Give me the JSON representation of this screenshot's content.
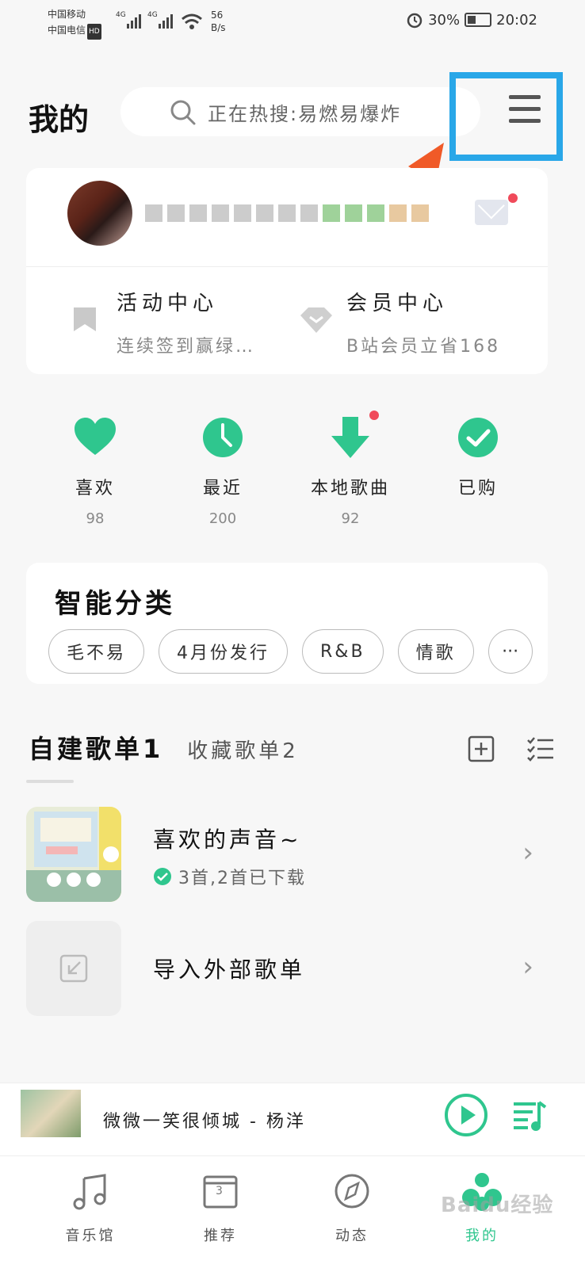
{
  "status_bar": {
    "carrier1": "中国移动",
    "carrier2": "中国电信",
    "hd": "HD",
    "net1": "4G",
    "net2": "4G",
    "speed_value": "56",
    "speed_unit": "B/s",
    "battery": "30%",
    "time": "20:02"
  },
  "header": {
    "title": "我的",
    "search_placeholder": "正在热搜:易燃易爆炸",
    "menu_icon": "hamburger-menu-icon"
  },
  "profile_card": {
    "activity_title": "活动中心",
    "activity_sub": "连续签到赢绿…",
    "vip_title": "会员中心",
    "vip_sub": "B站会员立省168"
  },
  "quick_actions": [
    {
      "label": "喜欢",
      "count": "98",
      "icon": "heart-icon"
    },
    {
      "label": "最近",
      "count": "200",
      "icon": "clock-icon"
    },
    {
      "label": "本地歌曲",
      "count": "92",
      "icon": "download-icon"
    },
    {
      "label": "已购",
      "count": "",
      "icon": "check-icon"
    }
  ],
  "smart_category": {
    "title": "智能分类",
    "chips": [
      "毛不易",
      "4月份发行",
      "R&B",
      "情歌"
    ],
    "more": "···"
  },
  "playlists": {
    "tab_created": "自建歌单1",
    "tab_collected": "收藏歌单2",
    "items": [
      {
        "title": "喜欢的声音~",
        "sub": "3首,2首已下载"
      },
      {
        "title": "导入外部歌单"
      }
    ]
  },
  "player": {
    "song": "微微一笑很倾城 - 杨洋"
  },
  "bottom_nav": [
    {
      "label": "音乐馆"
    },
    {
      "label": "推荐",
      "badge": "3"
    },
    {
      "label": "动态"
    },
    {
      "label": "我的"
    }
  ],
  "watermark": "Baidu经验",
  "colors": {
    "accent": "#2fc68e",
    "highlight_box": "#29a7e8",
    "arrow": "#f05a28",
    "badge_red": "#f04a5a"
  }
}
